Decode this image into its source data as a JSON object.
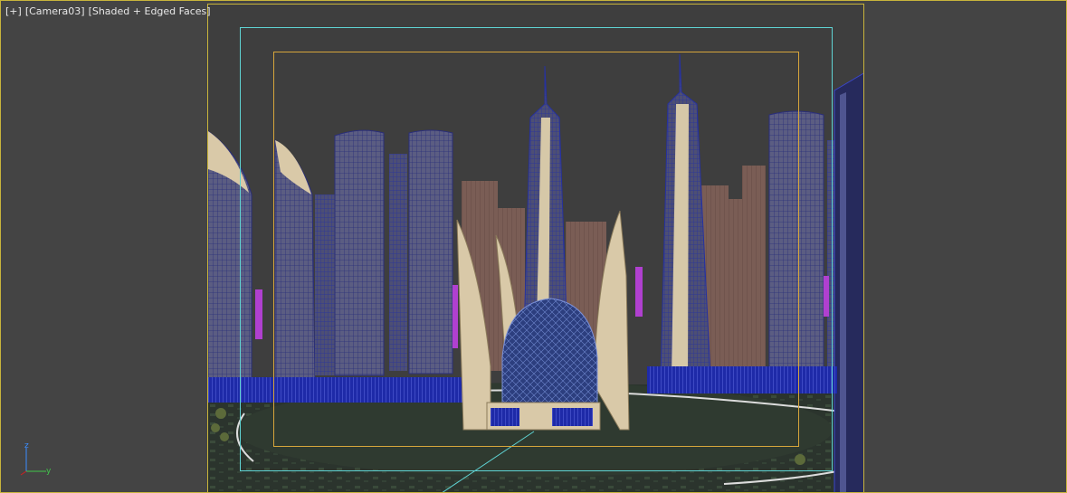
{
  "viewport": {
    "label_plus": "[+]",
    "label_camera": "[Camera03]",
    "label_mode": "[Shaded + Edged Faces]"
  },
  "gizmo": {
    "axis_z": "z",
    "axis_y": "y"
  },
  "colors": {
    "background": "#444444",
    "active_border": "#c8b43c",
    "safe_frame_outer": "#5fd3d3",
    "safe_frame_inner": "#d6a53b",
    "building_wire": "#3a46c8",
    "tower_face": "#5a5a7a",
    "tower_tan": "#d6c8a8",
    "tower_brown": "#7a5a50",
    "neon": "#b040d0"
  }
}
